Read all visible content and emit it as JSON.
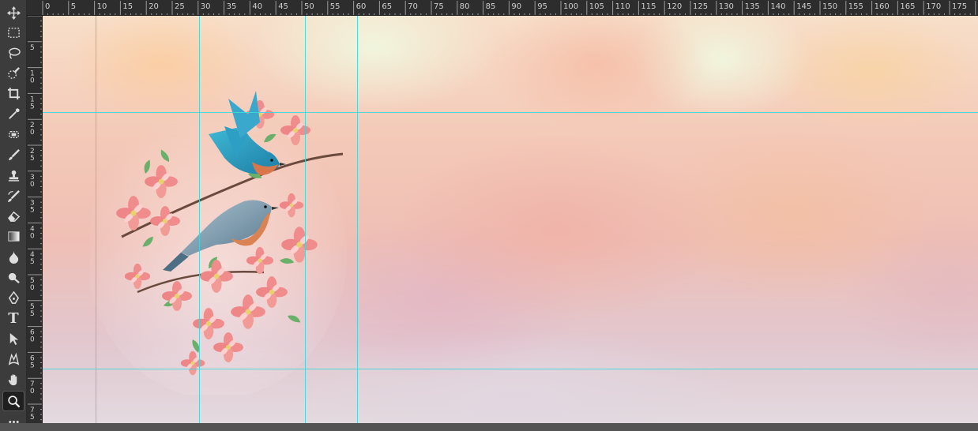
{
  "ruler": {
    "top_labels": [
      "0",
      "5",
      "10",
      "15",
      "20",
      "25",
      "30",
      "35",
      "40",
      "45",
      "50",
      "55",
      "60",
      "65",
      "70",
      "75",
      "80",
      "85",
      "90",
      "95",
      "100",
      "105",
      "110",
      "115",
      "120",
      "125",
      "130",
      "135",
      "140",
      "145",
      "150",
      "155",
      "160",
      "165",
      "170",
      "175"
    ],
    "left_labels": [
      "5",
      "1\n0",
      "1\n5",
      "2\n0",
      "2\n5",
      "3\n0",
      "3\n5",
      "4\n0",
      "4\n5",
      "5\n0",
      "5\n5",
      "6\n0",
      "6\n5",
      "7\n0",
      "7\n5"
    ]
  },
  "tools": [
    {
      "name": "move-tool",
      "icon": "move-icon"
    },
    {
      "name": "rectangular-marquee-tool",
      "icon": "marquee-icon"
    },
    {
      "name": "lasso-tool",
      "icon": "lasso-icon"
    },
    {
      "name": "quick-selection-tool",
      "icon": "quick-selection-icon"
    },
    {
      "name": "crop-tool",
      "icon": "crop-icon"
    },
    {
      "name": "eyedropper-tool",
      "icon": "eyedropper-icon"
    },
    {
      "name": "spot-healing-tool",
      "icon": "healing-icon"
    },
    {
      "name": "brush-tool",
      "icon": "brush-icon"
    },
    {
      "name": "clone-stamp-tool",
      "icon": "stamp-icon"
    },
    {
      "name": "history-brush-tool",
      "icon": "history-brush-icon"
    },
    {
      "name": "eraser-tool",
      "icon": "eraser-icon"
    },
    {
      "name": "gradient-tool",
      "icon": "gradient-icon"
    },
    {
      "name": "blur-tool",
      "icon": "blur-icon"
    },
    {
      "name": "dodge-tool",
      "icon": "dodge-icon"
    },
    {
      "name": "pen-tool",
      "icon": "pen-icon"
    },
    {
      "name": "type-tool",
      "icon": "type-icon"
    },
    {
      "name": "path-selection-tool",
      "icon": "path-selection-icon"
    },
    {
      "name": "custom-shape-tool",
      "icon": "custom-shape-icon"
    },
    {
      "name": "hand-tool",
      "icon": "hand-icon"
    },
    {
      "name": "zoom-tool",
      "icon": "zoom-icon",
      "active": true
    },
    {
      "name": "more-tools",
      "icon": "more-icon"
    }
  ],
  "type_tool_glyph": "T",
  "colors": {
    "guide": "#3fd6d9",
    "toolbar_bg": "#3c3c3c",
    "ruler_bg": "#2d2d2d",
    "active_tool_bg": "#1f1f1f"
  },
  "canvas": {
    "artwork": "bluebirds-on-pink-dogwood-painting"
  }
}
